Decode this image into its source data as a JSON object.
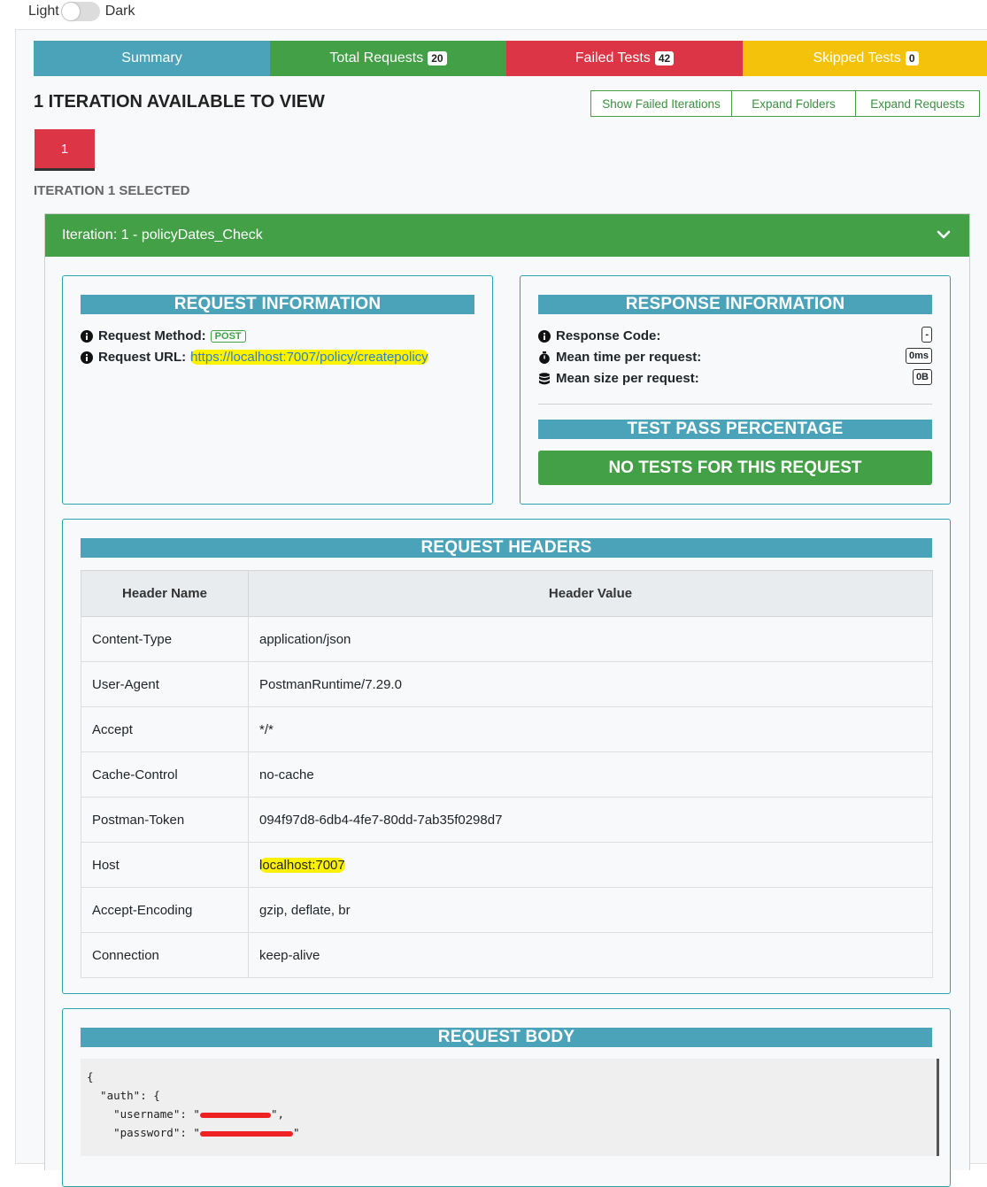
{
  "theme": {
    "light_label": "Light",
    "dark_label": "Dark"
  },
  "tabs": [
    {
      "label": "Summary",
      "badge": "",
      "color": "#4aa3b8"
    },
    {
      "label": "Total Requests",
      "badge": "20",
      "color": "#43a047"
    },
    {
      "label": "Failed Tests",
      "badge": "42",
      "color": "#dc3545"
    },
    {
      "label": "Skipped Tests",
      "badge": "0",
      "color": "#f5c20b"
    }
  ],
  "iterations": {
    "title": "1 ITERATION AVAILABLE TO VIEW",
    "buttons": {
      "show_failed": "Show Failed Iterations",
      "expand_folders": "Expand Folders",
      "expand_requests": "Expand Requests"
    },
    "selected_iteration": "1",
    "selected_label": "ITERATION 1 SELECTED"
  },
  "iteration_panel": {
    "header": "Iteration: 1 - policyDates_Check",
    "request_info": {
      "title": "REQUEST INFORMATION",
      "method_label": "Request Method:",
      "method": "POST",
      "url_label": "Request URL:",
      "url": "https://localhost:7007/policy/createpolicy"
    },
    "response_info": {
      "title": "RESPONSE INFORMATION",
      "code_label": "Response Code:",
      "code": "-",
      "time_label": "Mean time per request:",
      "time": "0ms",
      "size_label": "Mean size per request:",
      "size": "0B",
      "pass_title": "TEST PASS PERCENTAGE",
      "no_tests": "NO TESTS FOR THIS REQUEST"
    },
    "request_headers": {
      "title": "REQUEST HEADERS",
      "col_name": "Header Name",
      "col_value": "Header Value",
      "rows": [
        {
          "name": "Content-Type",
          "value": "application/json"
        },
        {
          "name": "User-Agent",
          "value": "PostmanRuntime/7.29.0"
        },
        {
          "name": "Accept",
          "value": "*/*"
        },
        {
          "name": "Cache-Control",
          "value": "no-cache"
        },
        {
          "name": "Postman-Token",
          "value": "094f97d8-6db4-4fe7-80dd-7ab35f0298d7"
        },
        {
          "name": "Host",
          "value": "localhost:7007"
        },
        {
          "name": "Accept-Encoding",
          "value": "gzip, deflate, br"
        },
        {
          "name": "Connection",
          "value": "keep-alive"
        }
      ]
    },
    "request_body": {
      "title": "REQUEST BODY",
      "line1": "{",
      "line2": "  \"auth\": {",
      "username_key": "    \"username\": \"",
      "password_key": "    \"password\": \""
    }
  }
}
